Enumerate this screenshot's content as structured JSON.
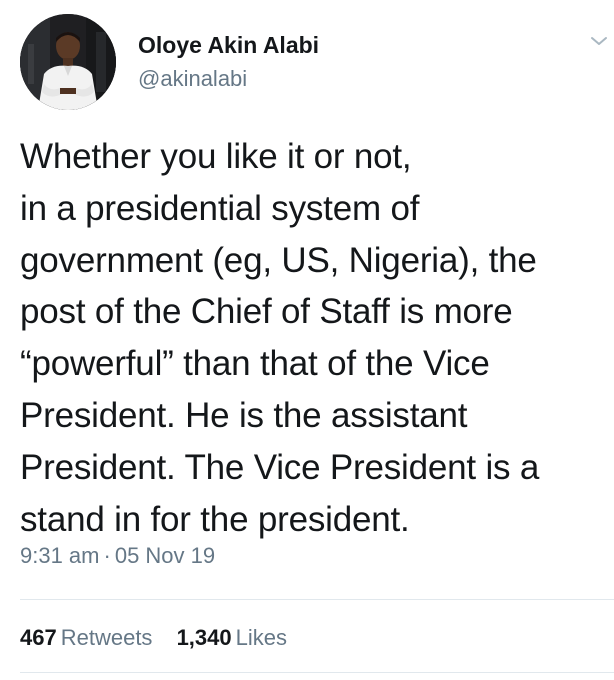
{
  "author": {
    "display_name": "Oloye Akin Alabi",
    "handle": "@akinalabi",
    "avatar_icon": "profile-photo"
  },
  "tweet": {
    "lines": [
      "Whether you like it or not,",
      "in a presidential system of",
      "government (eg, US, Nigeria), the",
      "post of the Chief of Staff is more",
      "“powerful” than that of the Vice",
      "President. He is the assistant",
      "President. The Vice President is a",
      "stand in for the president."
    ],
    "time": "9:31 am",
    "separator": "·",
    "date": "05 Nov 19"
  },
  "stats": {
    "retweets_count": "467",
    "retweets_label": "Retweets",
    "likes_count": "1,340",
    "likes_label": "Likes"
  },
  "icons": {
    "menu_caret": "chevron-down-icon"
  },
  "colors": {
    "text_primary": "#14171a",
    "text_secondary": "#657786",
    "divider": "#e1e8ed",
    "background": "#ffffff"
  }
}
